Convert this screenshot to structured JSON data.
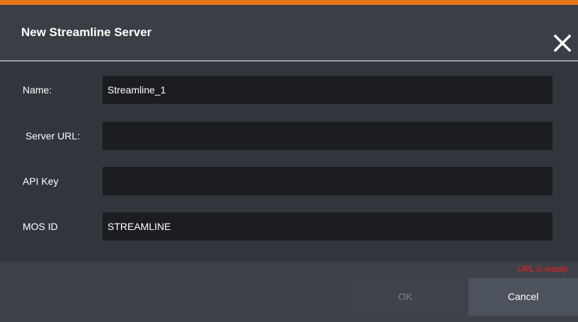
{
  "dialog": {
    "title": "New Streamline Server",
    "accent_color": "#e2751a",
    "close_icon": "close-icon"
  },
  "form": {
    "fields": [
      {
        "label": "Name:",
        "value": "Streamline_1",
        "placeholder": ""
      },
      {
        "label": "Server URL:",
        "value": "",
        "placeholder": ""
      },
      {
        "label": "API Key",
        "value": "",
        "placeholder": ""
      },
      {
        "label": "MOS ID",
        "value": "STREAMLINE",
        "placeholder": ""
      }
    ]
  },
  "footer": {
    "error_text": "URL is empty",
    "error_color": "#ff1a1a",
    "ok_label": "OK",
    "cancel_label": "Cancel"
  }
}
